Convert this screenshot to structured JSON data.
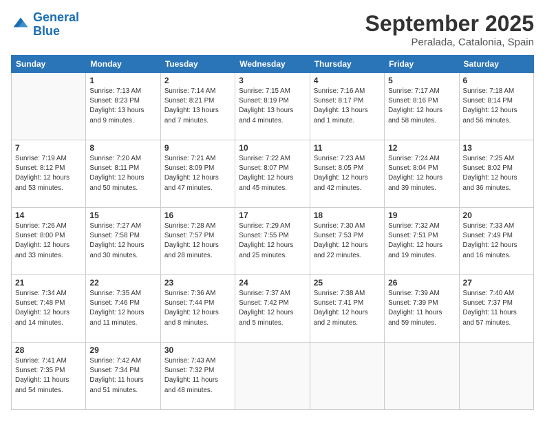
{
  "logo": {
    "line1": "General",
    "line2": "Blue"
  },
  "title": "September 2025",
  "location": "Peralada, Catalonia, Spain",
  "days_header": [
    "Sunday",
    "Monday",
    "Tuesday",
    "Wednesday",
    "Thursday",
    "Friday",
    "Saturday"
  ],
  "weeks": [
    [
      {
        "day": "",
        "info": ""
      },
      {
        "day": "1",
        "info": "Sunrise: 7:13 AM\nSunset: 8:23 PM\nDaylight: 13 hours\nand 9 minutes."
      },
      {
        "day": "2",
        "info": "Sunrise: 7:14 AM\nSunset: 8:21 PM\nDaylight: 13 hours\nand 7 minutes."
      },
      {
        "day": "3",
        "info": "Sunrise: 7:15 AM\nSunset: 8:19 PM\nDaylight: 13 hours\nand 4 minutes."
      },
      {
        "day": "4",
        "info": "Sunrise: 7:16 AM\nSunset: 8:17 PM\nDaylight: 13 hours\nand 1 minute."
      },
      {
        "day": "5",
        "info": "Sunrise: 7:17 AM\nSunset: 8:16 PM\nDaylight: 12 hours\nand 58 minutes."
      },
      {
        "day": "6",
        "info": "Sunrise: 7:18 AM\nSunset: 8:14 PM\nDaylight: 12 hours\nand 56 minutes."
      }
    ],
    [
      {
        "day": "7",
        "info": "Sunrise: 7:19 AM\nSunset: 8:12 PM\nDaylight: 12 hours\nand 53 minutes."
      },
      {
        "day": "8",
        "info": "Sunrise: 7:20 AM\nSunset: 8:11 PM\nDaylight: 12 hours\nand 50 minutes."
      },
      {
        "day": "9",
        "info": "Sunrise: 7:21 AM\nSunset: 8:09 PM\nDaylight: 12 hours\nand 47 minutes."
      },
      {
        "day": "10",
        "info": "Sunrise: 7:22 AM\nSunset: 8:07 PM\nDaylight: 12 hours\nand 45 minutes."
      },
      {
        "day": "11",
        "info": "Sunrise: 7:23 AM\nSunset: 8:05 PM\nDaylight: 12 hours\nand 42 minutes."
      },
      {
        "day": "12",
        "info": "Sunrise: 7:24 AM\nSunset: 8:04 PM\nDaylight: 12 hours\nand 39 minutes."
      },
      {
        "day": "13",
        "info": "Sunrise: 7:25 AM\nSunset: 8:02 PM\nDaylight: 12 hours\nand 36 minutes."
      }
    ],
    [
      {
        "day": "14",
        "info": "Sunrise: 7:26 AM\nSunset: 8:00 PM\nDaylight: 12 hours\nand 33 minutes."
      },
      {
        "day": "15",
        "info": "Sunrise: 7:27 AM\nSunset: 7:58 PM\nDaylight: 12 hours\nand 30 minutes."
      },
      {
        "day": "16",
        "info": "Sunrise: 7:28 AM\nSunset: 7:57 PM\nDaylight: 12 hours\nand 28 minutes."
      },
      {
        "day": "17",
        "info": "Sunrise: 7:29 AM\nSunset: 7:55 PM\nDaylight: 12 hours\nand 25 minutes."
      },
      {
        "day": "18",
        "info": "Sunrise: 7:30 AM\nSunset: 7:53 PM\nDaylight: 12 hours\nand 22 minutes."
      },
      {
        "day": "19",
        "info": "Sunrise: 7:32 AM\nSunset: 7:51 PM\nDaylight: 12 hours\nand 19 minutes."
      },
      {
        "day": "20",
        "info": "Sunrise: 7:33 AM\nSunset: 7:49 PM\nDaylight: 12 hours\nand 16 minutes."
      }
    ],
    [
      {
        "day": "21",
        "info": "Sunrise: 7:34 AM\nSunset: 7:48 PM\nDaylight: 12 hours\nand 14 minutes."
      },
      {
        "day": "22",
        "info": "Sunrise: 7:35 AM\nSunset: 7:46 PM\nDaylight: 12 hours\nand 11 minutes."
      },
      {
        "day": "23",
        "info": "Sunrise: 7:36 AM\nSunset: 7:44 PM\nDaylight: 12 hours\nand 8 minutes."
      },
      {
        "day": "24",
        "info": "Sunrise: 7:37 AM\nSunset: 7:42 PM\nDaylight: 12 hours\nand 5 minutes."
      },
      {
        "day": "25",
        "info": "Sunrise: 7:38 AM\nSunset: 7:41 PM\nDaylight: 12 hours\nand 2 minutes."
      },
      {
        "day": "26",
        "info": "Sunrise: 7:39 AM\nSunset: 7:39 PM\nDaylight: 11 hours\nand 59 minutes."
      },
      {
        "day": "27",
        "info": "Sunrise: 7:40 AM\nSunset: 7:37 PM\nDaylight: 11 hours\nand 57 minutes."
      }
    ],
    [
      {
        "day": "28",
        "info": "Sunrise: 7:41 AM\nSunset: 7:35 PM\nDaylight: 11 hours\nand 54 minutes."
      },
      {
        "day": "29",
        "info": "Sunrise: 7:42 AM\nSunset: 7:34 PM\nDaylight: 11 hours\nand 51 minutes."
      },
      {
        "day": "30",
        "info": "Sunrise: 7:43 AM\nSunset: 7:32 PM\nDaylight: 11 hours\nand 48 minutes."
      },
      {
        "day": "",
        "info": ""
      },
      {
        "day": "",
        "info": ""
      },
      {
        "day": "",
        "info": ""
      },
      {
        "day": "",
        "info": ""
      }
    ]
  ]
}
